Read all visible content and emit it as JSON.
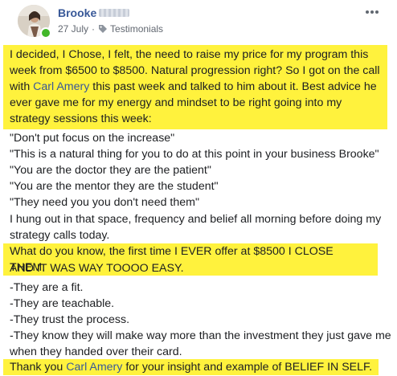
{
  "author": {
    "name": "Brooke",
    "avatar": "avatar-photo",
    "online": true
  },
  "meta": {
    "date": "27 July",
    "separator": "·",
    "tag_icon": "tag-icon",
    "category": "Testimonials"
  },
  "menu_icon": "more-horizontal-icon",
  "post": {
    "p1_a": "I decided, I Chose, I felt, the need to raise my price for my program this week from $6500 to $8500. Natural progression right? So I got on the call with ",
    "p1_link": "Carl Amery",
    "p1_b": " this past week and talked to him about it. Best advice he ever gave me for my energy and mindset to be right going into my strategy sessions this week:",
    "quotes": [
      "\"Don't put focus on the increase\"",
      "\"This is a natural thing for you to do at this point in your business Brooke\"",
      "\"You are the doctor they are the patient\"",
      "\"You are the mentor they are the student\"",
      "\"They need you you don't need them\""
    ],
    "p2": "I hung out in that space, frequency and belief all morning before doing my strategy calls today.",
    "p3_highlight": "What do you know, the first time I EVER offer at $8500 I CLOSE THEM.",
    "p3_rest": "AND IT WAS WAY TOOOO EASY.",
    "list": [
      "-They are a fit.",
      "-They are teachable.",
      "-They trust the process.",
      "-They know they will make way more than the investment they just gave me when they handed over their card."
    ],
    "p4_a": "Thank you ",
    "p4_link": "Carl Amery",
    "p4_b": " for your insight and example of BELIEF IN SELF."
  },
  "colors": {
    "highlight": "#fff23d",
    "link": "#385898",
    "online": "#42b72a",
    "meta_text": "#616770"
  }
}
